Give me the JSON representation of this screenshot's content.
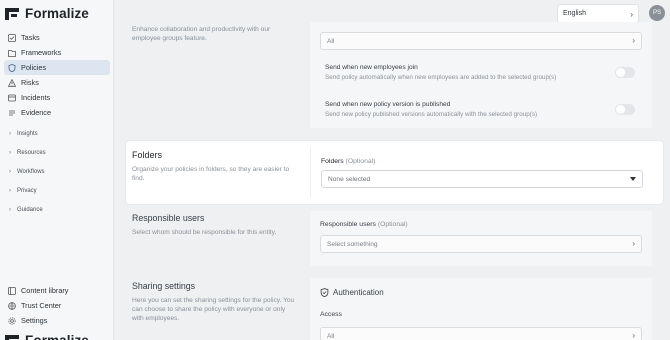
{
  "brand": {
    "name": "Formalize"
  },
  "nav": {
    "items": [
      {
        "label": "Tasks",
        "icon": "tasks-icon"
      },
      {
        "label": "Frameworks",
        "icon": "frameworks-icon"
      },
      {
        "label": "Policies",
        "icon": "shield-icon",
        "active": true
      },
      {
        "label": "Risks",
        "icon": "warning-icon"
      },
      {
        "label": "Incidents",
        "icon": "incidents-icon"
      },
      {
        "label": "Evidence",
        "icon": "evidence-icon"
      }
    ],
    "groups": [
      "Insights",
      "Resources",
      "Workflows",
      "Privacy",
      "Guidance"
    ],
    "bottom": [
      {
        "label": "Content library",
        "icon": "library-icon"
      },
      {
        "label": "Trust Center",
        "icon": "globe-icon"
      },
      {
        "label": "Settings",
        "icon": "gear-icon"
      }
    ]
  },
  "topbar": {
    "language": "English",
    "avatar_initials": "PS"
  },
  "top_section": {
    "desc": "Enhance collaboration and productivity with our employee groups feature.",
    "select_value": "All",
    "opt1_title": "Send when new employees join",
    "opt1_desc": "Send policy automatically when new employees are added to the selected group(s)",
    "opt2_title": "Send when new policy version is published",
    "opt2_desc": "Send new policy published versions automatically with the selected group(s)"
  },
  "folders": {
    "title": "Folders",
    "desc": "Organize your policies in folders, so they are easier to find.",
    "label": "Folders",
    "label_optional": "(Optional)",
    "placeholder": "None selected"
  },
  "responsible": {
    "title": "Responsible users",
    "desc": "Select whom should be responsible for this entity.",
    "label": "Responsible users",
    "label_optional": "(Optional)",
    "placeholder": "Select something"
  },
  "sharing": {
    "title": "Sharing settings",
    "desc": "Here you can set the sharing settings for the policy. You can choose to share the policy with everyone or only with employees.",
    "auth_title": "Authentication",
    "access_label": "Access",
    "access_value": "All"
  }
}
